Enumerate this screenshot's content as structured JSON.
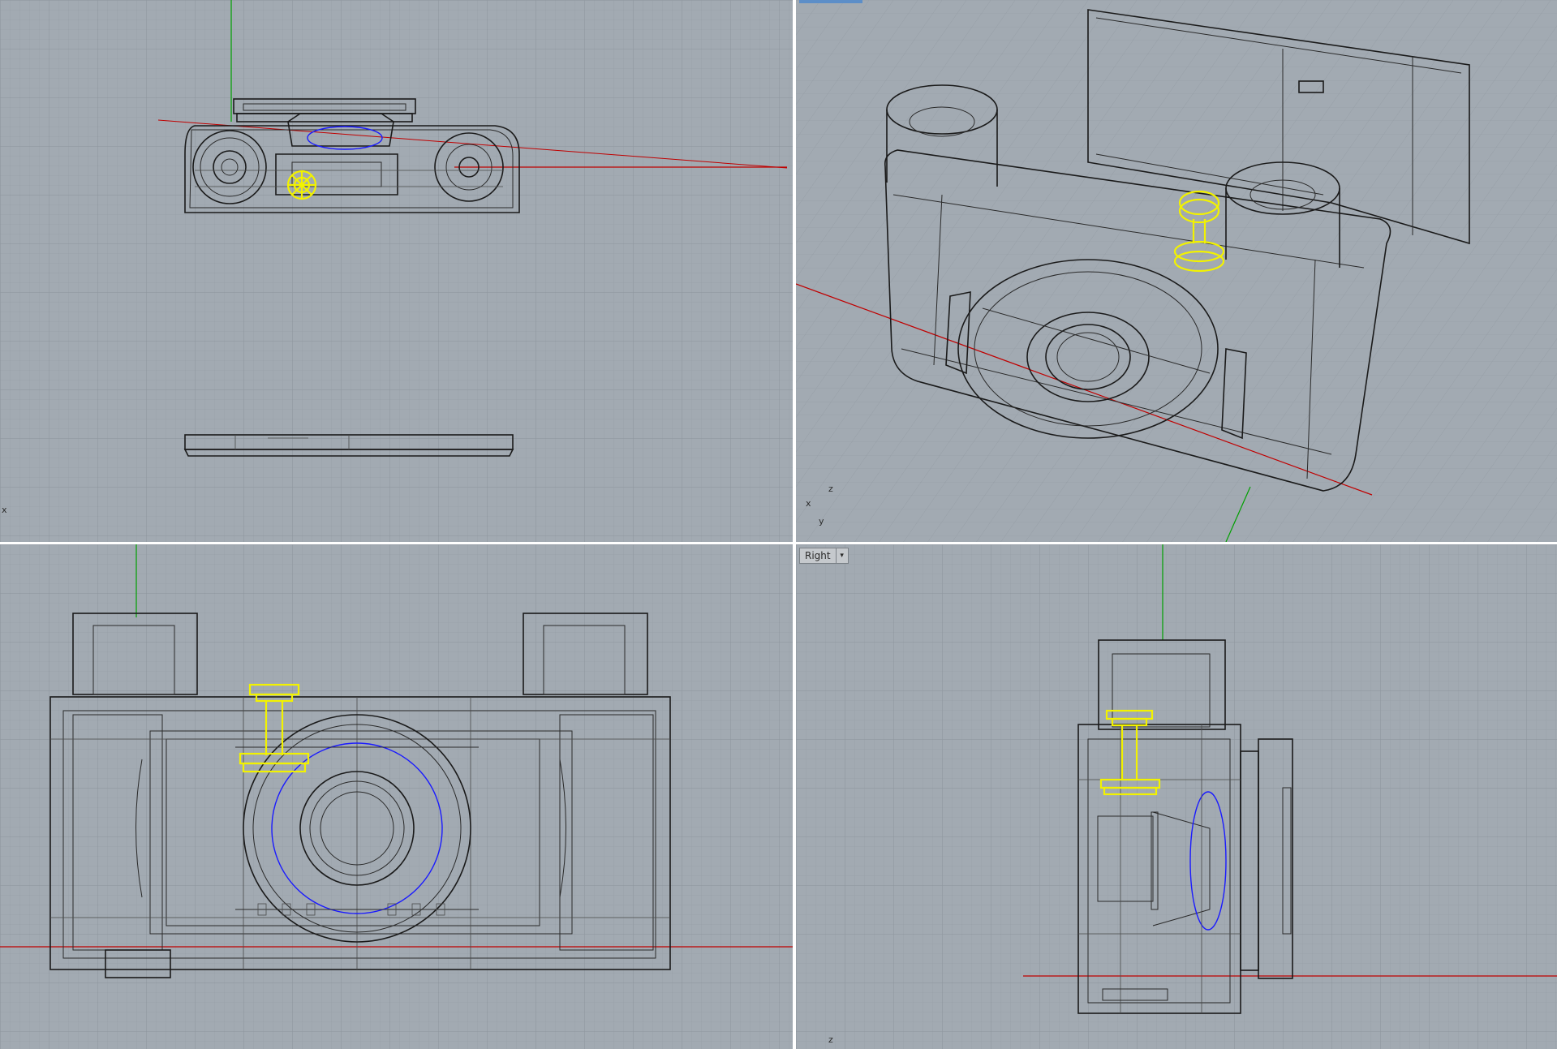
{
  "app": {
    "accent_color": "#f2f200",
    "grid_color": "#a2aab2"
  },
  "viewports": {
    "top": {
      "axis_labels": [
        "x"
      ]
    },
    "perspective": {
      "axis_labels": [
        "z",
        "x",
        "y"
      ]
    },
    "front": {
      "axis_labels": []
    },
    "right": {
      "label": "Right",
      "dropdown_icon": "chevron-down-icon",
      "axis_labels": [
        "z"
      ]
    }
  }
}
